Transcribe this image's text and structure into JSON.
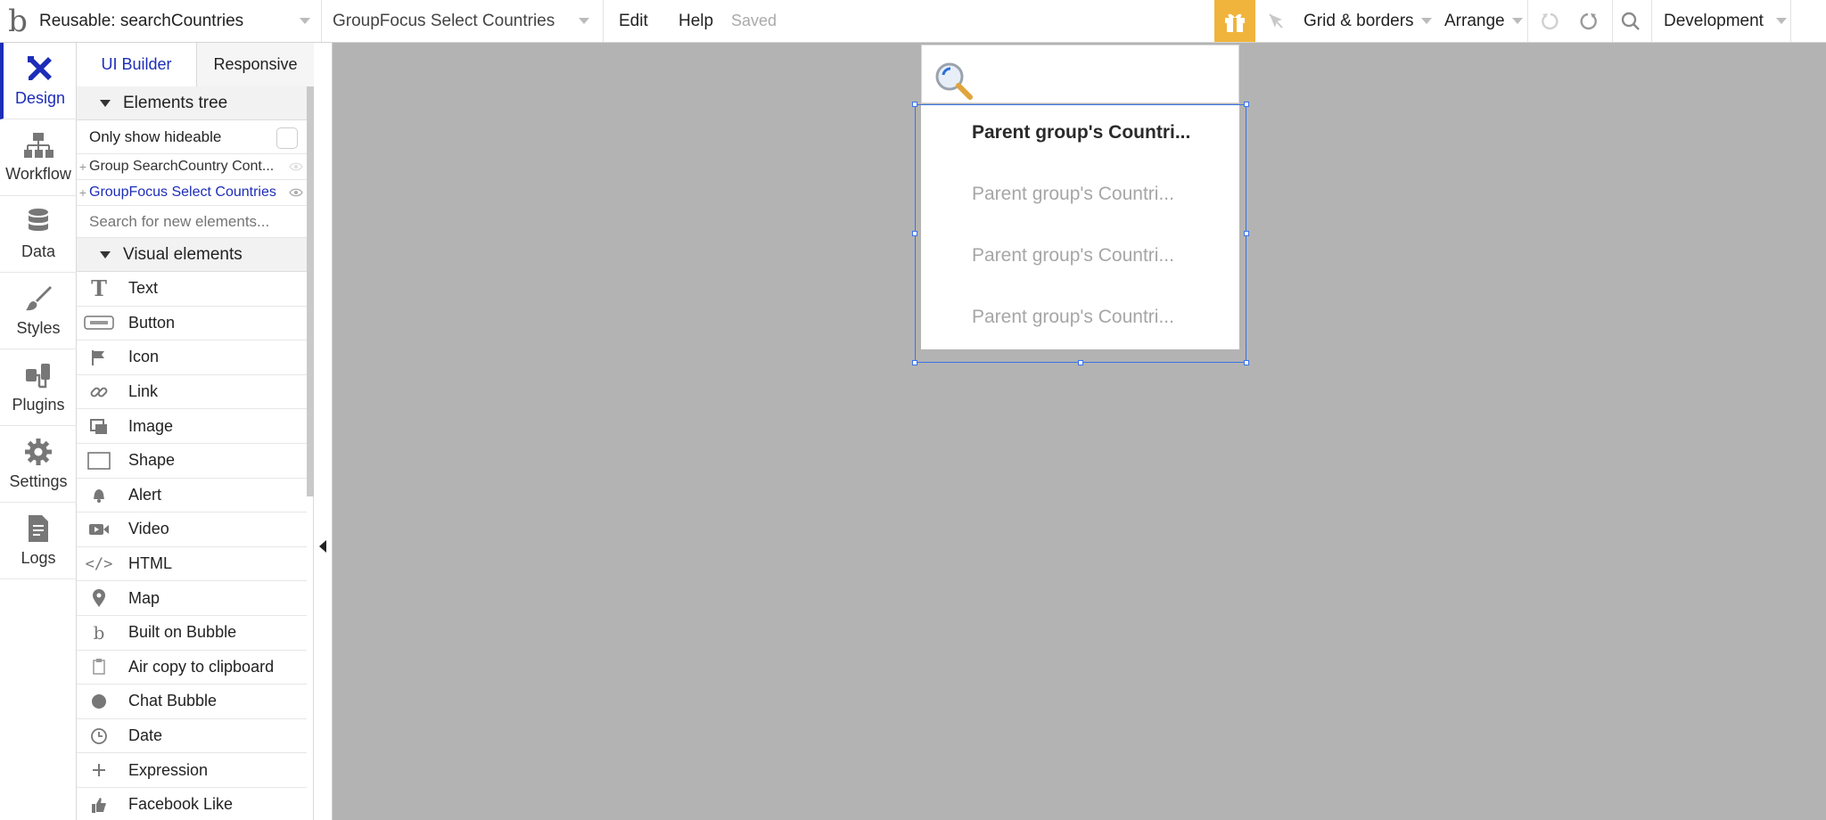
{
  "topbar": {
    "logo": "b",
    "page_select": "Reusable: searchCountries",
    "element_select": "GroupFocus Select Countries",
    "edit": "Edit",
    "help": "Help",
    "saved": "Saved",
    "grid_borders": "Grid & borders",
    "arrange": "Arrange",
    "environment": "Development"
  },
  "rail": {
    "design": "Design",
    "workflow": "Workflow",
    "data": "Data",
    "styles": "Styles",
    "plugins": "Plugins",
    "settings": "Settings",
    "logs": "Logs"
  },
  "panel": {
    "tab_ui_builder": "UI Builder",
    "tab_responsive": "Responsive",
    "elements_tree": "Elements tree",
    "only_show_hideable": "Only show hideable",
    "tree_items": [
      {
        "label": "Group SearchCountry Cont...",
        "color": "#333333"
      },
      {
        "label": "GroupFocus Select Countries",
        "color": "#1d2db8"
      }
    ],
    "search_placeholder": "Search for new elements...",
    "visual_elements": "Visual elements",
    "elements": [
      {
        "label": "Text",
        "icon": "text-icon"
      },
      {
        "label": "Button",
        "icon": "button-icon"
      },
      {
        "label": "Icon",
        "icon": "flag-icon"
      },
      {
        "label": "Link",
        "icon": "link-icon"
      },
      {
        "label": "Image",
        "icon": "image-icon"
      },
      {
        "label": "Shape",
        "icon": "shape-icon"
      },
      {
        "label": "Alert",
        "icon": "bell-icon"
      },
      {
        "label": "Video",
        "icon": "video-icon"
      },
      {
        "label": "HTML",
        "icon": "code-icon"
      },
      {
        "label": "Map",
        "icon": "map-pin-icon"
      },
      {
        "label": "Built on Bubble",
        "icon": "bubble-logo-icon"
      },
      {
        "label": "Air copy to clipboard",
        "icon": "clipboard-icon"
      },
      {
        "label": "Chat Bubble",
        "icon": "chat-icon"
      },
      {
        "label": "Date",
        "icon": "clock-icon"
      },
      {
        "label": "Expression",
        "icon": "plus-icon"
      },
      {
        "label": "Facebook Like",
        "icon": "thumbs-up-icon"
      }
    ]
  },
  "canvas": {
    "list_items": [
      {
        "label": "Parent group's Countri...",
        "style": "bold"
      },
      {
        "label": "Parent group's Countri...",
        "style": "muted"
      },
      {
        "label": "Parent group's Countri...",
        "style": "muted"
      },
      {
        "label": "Parent group's Countri...",
        "style": "muted"
      }
    ]
  },
  "colors": {
    "accent": "#1d2db8",
    "selection": "#3a73e8",
    "gift": "#f0b43c",
    "canvas_bg": "#b3b3b3"
  }
}
